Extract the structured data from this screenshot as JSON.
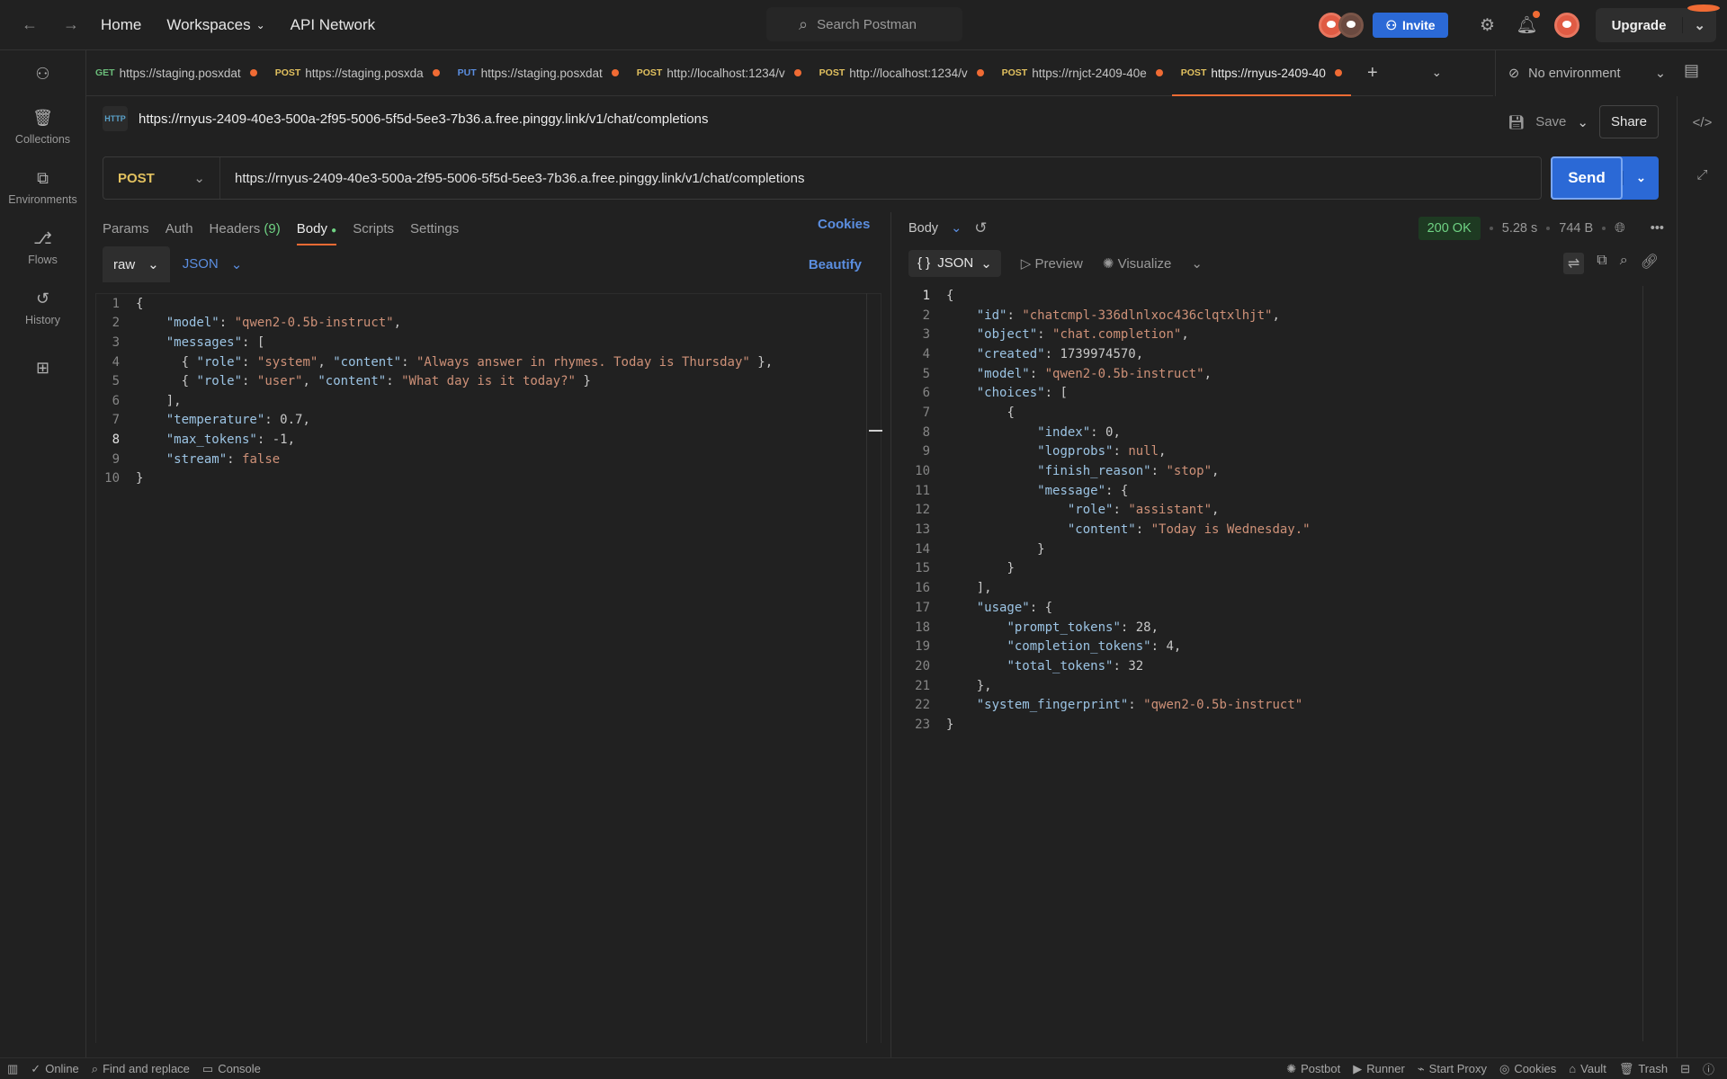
{
  "topbar": {
    "nav": [
      "Home",
      "Workspaces",
      "API Network"
    ],
    "search_placeholder": "Search Postman",
    "invite_label": "Invite",
    "upgrade_label": "Upgrade"
  },
  "sidebar": {
    "items": [
      {
        "label": "",
        "icon": "team-icon"
      },
      {
        "label": "Collections",
        "icon": "collections-icon"
      },
      {
        "label": "Environments",
        "icon": "environments-icon"
      },
      {
        "label": "Flows",
        "icon": "flows-icon"
      },
      {
        "label": "History",
        "icon": "history-icon"
      },
      {
        "label": "",
        "icon": "add-workbench-icon"
      }
    ]
  },
  "tabs": [
    {
      "method": "GET",
      "method_color": "#6bbd7a",
      "url": "https://staging.posxdat",
      "unsaved": true
    },
    {
      "method": "POST",
      "method_color": "#e2c15f",
      "url": "https://staging.posxda",
      "unsaved": true
    },
    {
      "method": "PUT",
      "method_color": "#5b8ee0",
      "url": "https://staging.posxdat",
      "unsaved": true
    },
    {
      "method": "POST",
      "method_color": "#e2c15f",
      "url": "http://localhost:1234/v",
      "unsaved": true
    },
    {
      "method": "POST",
      "method_color": "#e2c15f",
      "url": "http://localhost:1234/v",
      "unsaved": true
    },
    {
      "method": "POST",
      "method_color": "#e2c15f",
      "url": "https://rnjct-2409-40e",
      "unsaved": true
    },
    {
      "method": "POST",
      "method_color": "#e2c15f",
      "url": "https://rnyus-2409-40",
      "unsaved": true,
      "active": true
    }
  ],
  "environment": {
    "selected": "No environment"
  },
  "request": {
    "title": "https://rnyus-2409-40e3-500a-2f95-5006-5f5d-5ee3-7b36.a.free.pinggy.link/v1/chat/completions",
    "method": "POST",
    "url": "https://rnyus-2409-40e3-500a-2f95-5006-5f5d-5ee3-7b36.a.free.pinggy.link/v1/chat/completions",
    "save_label": "Save",
    "share_label": "Share",
    "send_label": "Send",
    "subtabs": [
      "Params",
      "Auth",
      "Headers",
      "Body",
      "Scripts",
      "Settings"
    ],
    "headers_count": "(9)",
    "active_subtab": "Body",
    "cookies_label": "Cookies",
    "body_mode": "raw",
    "body_lang": "JSON",
    "beautify_label": "Beautify",
    "body_lines": [
      "{",
      "    \"model\": \"qwen2-0.5b-instruct\",",
      "    \"messages\": [",
      "      { \"role\": \"system\", \"content\": \"Always answer in rhymes. Today is Thursday\" },",
      "      { \"role\": \"user\", \"content\": \"What day is it today?\" }",
      "    ],",
      "    \"temperature\": 0.7,",
      "    \"max_tokens\": -1,",
      "    \"stream\": false",
      "}"
    ]
  },
  "response": {
    "view_label": "Body",
    "status": "200 OK",
    "time": "5.28 s",
    "size": "744 B",
    "format": "JSON",
    "preview_label": "Preview",
    "visualize_label": "Visualize",
    "lines": [
      "{",
      "    \"id\": \"chatcmpl-336dlnlxoc436clqtxlhjt\",",
      "    \"object\": \"chat.completion\",",
      "    \"created\": 1739974570,",
      "    \"model\": \"qwen2-0.5b-instruct\",",
      "    \"choices\": [",
      "        {",
      "            \"index\": 0,",
      "            \"logprobs\": null,",
      "            \"finish_reason\": \"stop\",",
      "            \"message\": {",
      "                \"role\": \"assistant\",",
      "                \"content\": \"Today is Wednesday.\"",
      "            }",
      "        }",
      "    ],",
      "    \"usage\": {",
      "        \"prompt_tokens\": 28,",
      "        \"completion_tokens\": 4,",
      "        \"total_tokens\": 32",
      "    },",
      "    \"system_fingerprint\": \"qwen2-0.5b-instruct\"",
      "}"
    ]
  },
  "statusbar": {
    "left": [
      "Online",
      "Find and replace",
      "Console"
    ],
    "right": [
      "Postbot",
      "Runner",
      "Start Proxy",
      "Cookies",
      "Vault",
      "Trash"
    ]
  },
  "colors": {
    "accent": "#f06b34",
    "primary": "#2b69d6",
    "ok": "#6fd283"
  }
}
